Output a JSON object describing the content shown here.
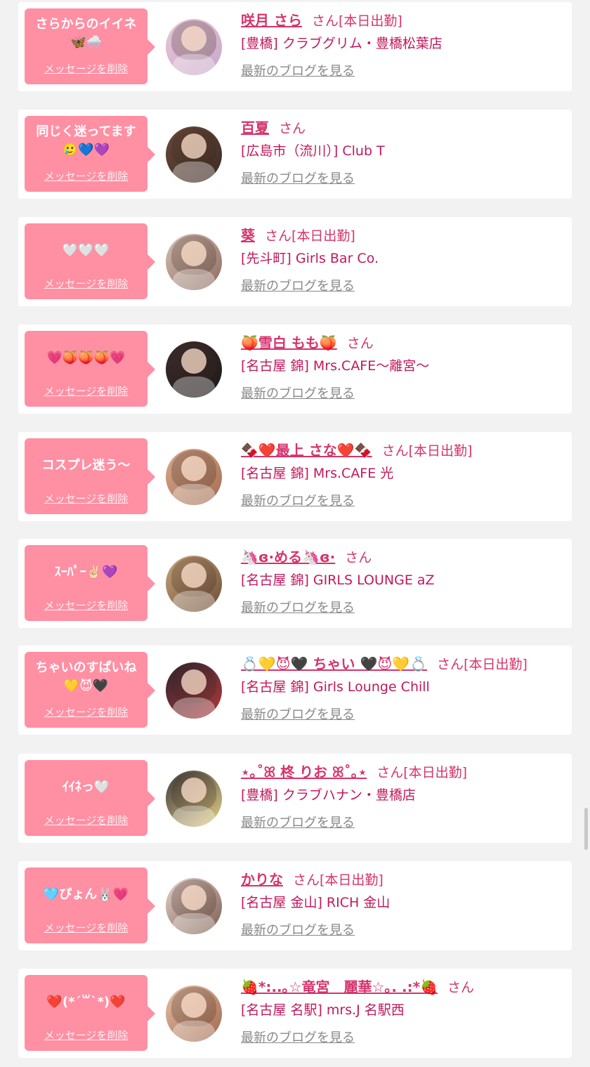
{
  "colors": {
    "bubble": "#ff8fa3",
    "name": "#d6336c",
    "shop": "#c2185b",
    "link": "#888888",
    "background": "#f2f2f2"
  },
  "delete_label": "メッセージを削除",
  "blog_label": "最新のブログを見る",
  "cards": [
    {
      "message": "さらからのイイネ\n🦋🌨️",
      "name": "咲月 さら",
      "honorific": "さん",
      "tag": "[本日出勤]",
      "shop": "[豊橋] クラブグリム・豊橋松葉店",
      "avatar_colors": [
        "#e9c6d8",
        "#c7a7c9"
      ]
    },
    {
      "message": "同じく迷ってます\n🥲💙💜",
      "name": "百夏",
      "honorific": "さん",
      "tag": "",
      "shop": "[広島市（流川）] Club T",
      "avatar_colors": [
        "#6b4a3a",
        "#3a2a24"
      ]
    },
    {
      "message": "🤍🤍🤍",
      "name": "葵",
      "honorific": "さん",
      "tag": "[本日出勤]",
      "shop": "[先斗町] Girls Bar Co.",
      "avatar_colors": [
        "#d8c0b4",
        "#8a6a5e"
      ]
    },
    {
      "message": "💗🍑🍑🍑💗",
      "name": "🍑雪白 もも🍑",
      "honorific": "さん",
      "tag": "",
      "shop": "[名古屋 錦] Mrs.CAFE〜離宮〜",
      "avatar_colors": [
        "#3a2c2c",
        "#1f1a1a"
      ]
    },
    {
      "message": "コスプレ迷う〜",
      "name": "🍫❤️最上 さな❤️🍫",
      "honorific": "さん",
      "tag": "[本日出勤]",
      "shop": "[名古屋 錦] Mrs.CAFE 光",
      "avatar_colors": [
        "#d9a88c",
        "#a26d52"
      ]
    },
    {
      "message": "ｽｰﾊﾟｰ✌🏻💜",
      "name": "🦄ɞ·める🦄ɞ·",
      "honorific": "さん",
      "tag": "",
      "shop": "[名古屋 錦] GIRLS LOUNGE aZ",
      "avatar_colors": [
        "#c8a67c",
        "#6b4b34"
      ]
    },
    {
      "message": "ちゃいのすぱいね\n💛😈🖤",
      "name": "💍💛😈🖤 ちゃい 🖤😈💛💍",
      "honorific": "さん",
      "tag": "[本日出勤]",
      "shop": "[名古屋 錦] Girls Lounge Chill",
      "avatar_colors": [
        "#2b2430",
        "#b23a3a"
      ]
    },
    {
      "message": "ｲｲﾈっ🤍",
      "name": "⋆｡˚ꕤ 柊 りお ꕤ˚｡⋆",
      "honorific": "さん",
      "tag": "[本日出勤]",
      "shop": "[豊橋] クラブハナン・豊橋店",
      "avatar_colors": [
        "#3a3a3a",
        "#e6cf86"
      ]
    },
    {
      "message": "🩵ぴょん🐰💗",
      "name": "かりな",
      "honorific": "さん",
      "tag": "[本日出勤]",
      "shop": "[名古屋 金山] RICH 金山",
      "avatar_colors": [
        "#e8d4cc",
        "#7a5a4e"
      ]
    },
    {
      "message": "❤️(*´꒳`*)❤️",
      "name": "🍓*:..｡☆竜宮　麗華☆｡. .:*🍓",
      "honorific": "さん",
      "tag": "",
      "shop": "[名古屋 名駅] mrs.J 名駅西",
      "avatar_colors": [
        "#e7c2a8",
        "#a0654b"
      ]
    }
  ]
}
